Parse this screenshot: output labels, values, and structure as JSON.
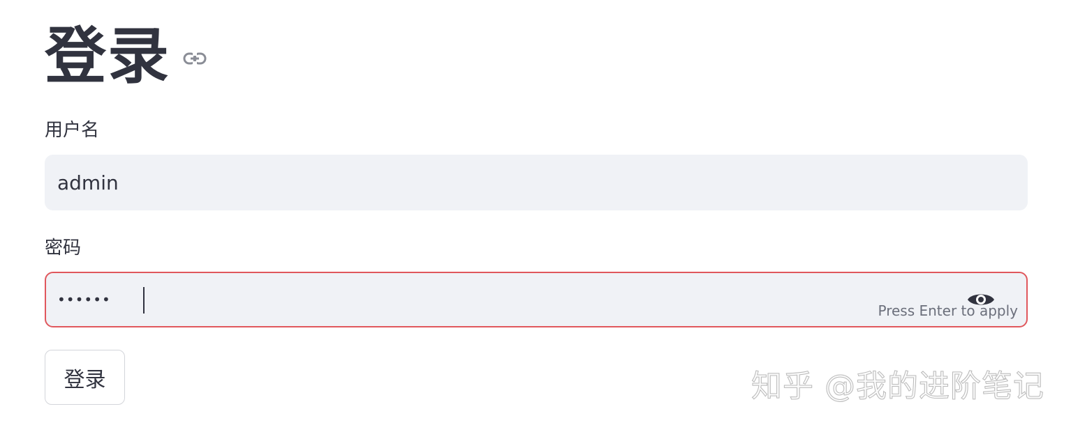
{
  "form": {
    "title": "登录",
    "title_link_icon": "link-icon",
    "username": {
      "label": "用户名",
      "value": "admin"
    },
    "password": {
      "label": "密码",
      "masked_value": "••••••",
      "toggle_icon": "eye-icon",
      "hint": "Press Enter to apply",
      "border_color": "#e0575c"
    },
    "submit_label": "登录"
  },
  "watermark": {
    "text": "知乎 @我的进阶笔记"
  },
  "colors": {
    "text": "#31333f",
    "input_bg": "#f0f2f6",
    "hint": "#6b6f7b"
  }
}
